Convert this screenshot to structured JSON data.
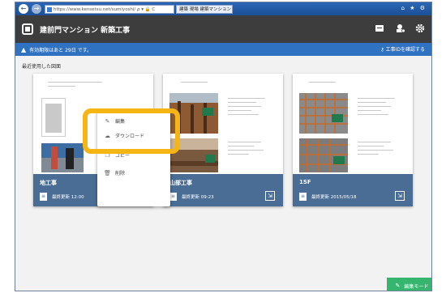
{
  "browser": {
    "back_glyph": "←",
    "forward_glyph": "→",
    "address": "https://www.kensetsu.net/sumiyoshi/ ρ ▾ 🔒 C",
    "tab_title": "建築 現場 建築マンション",
    "tab_close": "×",
    "window_icons": "⌂ ★ ⚙"
  },
  "header": {
    "title": "建前門マンション 新築工事",
    "icons": [
      "chat-icon",
      "settings-user-icon",
      "gear-icon"
    ]
  },
  "notice": {
    "text": "有効期限はあと 29日 です。",
    "link": "工事IDを確認する"
  },
  "section_label": "最近使用した図面",
  "cards": [
    {
      "name": "地工事",
      "meta": "最終更新 12:00"
    },
    {
      "name": "山部工事",
      "meta": "最終更新 09:23"
    },
    {
      "name": "1SF",
      "meta": "最終更新 2015/05/18"
    }
  ],
  "context_menu": {
    "items": [
      {
        "label": "編集"
      },
      {
        "label": "ダウンロード"
      },
      {
        "label": "コピー"
      },
      {
        "label": "削除"
      }
    ]
  },
  "mode_button": {
    "label": "編集モード"
  },
  "colors": {
    "browser_bar": "#1c4f96",
    "app_header": "#3d3d3d",
    "notice_bar": "#2f72c2",
    "card_footer": "#4a6d96",
    "highlight": "#f5b515",
    "mode_button": "#36b56f"
  }
}
